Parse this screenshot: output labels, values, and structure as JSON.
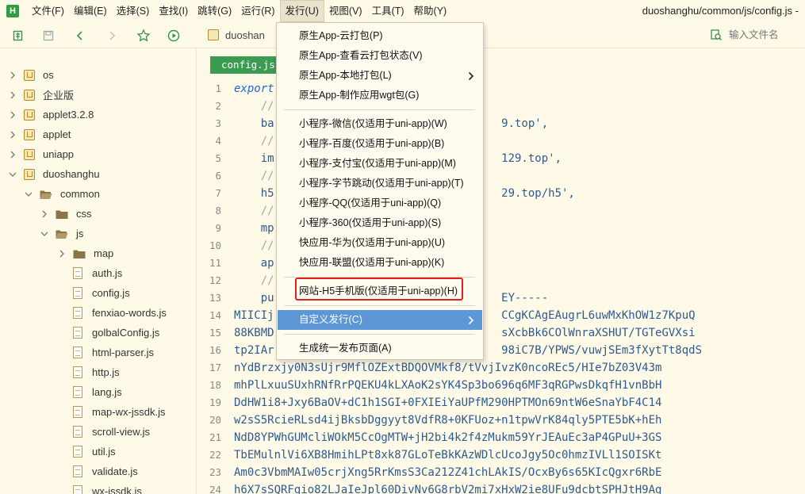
{
  "app": {
    "logo_text": "H",
    "title_path": "duoshanghu/common/js/config.js -"
  },
  "menubar": {
    "items": [
      "文件(F)",
      "编辑(E)",
      "选择(S)",
      "查找(I)",
      "跳转(G)",
      "运行(R)",
      "发行(U)",
      "视图(V)",
      "工具(T)",
      "帮助(Y)"
    ],
    "active": "发行(U)"
  },
  "toolbar": {
    "breadcrumb": "duoshan",
    "file_search_placeholder": "输入文件名",
    "icons": [
      "new-file-icon",
      "save-icon",
      "back-icon",
      "forward-icon",
      "star-icon",
      "run-icon"
    ]
  },
  "sidebar": {
    "tree": [
      {
        "label": "os",
        "type": "project",
        "depth": 0,
        "expanded": false
      },
      {
        "label": "企业版",
        "type": "project",
        "depth": 0,
        "expanded": false
      },
      {
        "label": "applet3.2.8",
        "type": "project",
        "depth": 0,
        "expanded": false
      },
      {
        "label": "applet",
        "type": "project",
        "depth": 0,
        "expanded": false
      },
      {
        "label": "uniapp",
        "type": "project",
        "depth": 0,
        "expanded": false
      },
      {
        "label": "duoshanghu",
        "type": "project",
        "depth": 0,
        "expanded": true
      },
      {
        "label": "common",
        "type": "folder",
        "depth": 1,
        "expanded": true
      },
      {
        "label": "css",
        "type": "folder",
        "depth": 2,
        "expanded": false
      },
      {
        "label": "js",
        "type": "folder",
        "depth": 2,
        "expanded": true
      },
      {
        "label": "map",
        "type": "folder",
        "depth": 3,
        "expanded": false
      },
      {
        "label": "auth.js",
        "type": "file",
        "depth": 3
      },
      {
        "label": "config.js",
        "type": "file",
        "depth": 3
      },
      {
        "label": "fenxiao-words.js",
        "type": "file",
        "depth": 3
      },
      {
        "label": "golbalConfig.js",
        "type": "file",
        "depth": 3
      },
      {
        "label": "html-parser.js",
        "type": "file",
        "depth": 3
      },
      {
        "label": "http.js",
        "type": "file",
        "depth": 3
      },
      {
        "label": "lang.js",
        "type": "file",
        "depth": 3
      },
      {
        "label": "map-wx-jssdk.js",
        "type": "file",
        "depth": 3
      },
      {
        "label": "scroll-view.js",
        "type": "file",
        "depth": 3
      },
      {
        "label": "util.js",
        "type": "file",
        "depth": 3
      },
      {
        "label": "validate.js",
        "type": "file",
        "depth": 3
      },
      {
        "label": "wx-jssdk.js",
        "type": "file",
        "depth": 3
      }
    ]
  },
  "editor": {
    "tab": "config.js",
    "lines": [
      {
        "n": "1",
        "text": "export",
        "cls": "kw"
      },
      {
        "n": "2",
        "text": "    //",
        "cls": "cm"
      },
      {
        "n": "3",
        "text": "    ba                                  9.top',",
        "cls": "str"
      },
      {
        "n": "4",
        "text": "    //",
        "cls": "cm"
      },
      {
        "n": "5",
        "text": "    im                                  129.top',",
        "cls": "str"
      },
      {
        "n": "6",
        "text": "    //",
        "cls": "cm"
      },
      {
        "n": "7",
        "text": "    h5                                  29.top/h5',",
        "cls": "str"
      },
      {
        "n": "8",
        "text": "    //",
        "cls": "cm"
      },
      {
        "n": "9",
        "text": "    mp",
        "cls": "str"
      },
      {
        "n": "10",
        "text": "    //",
        "cls": "cm"
      },
      {
        "n": "11",
        "text": "    ap",
        "cls": "str"
      },
      {
        "n": "12",
        "text": "    //",
        "cls": "cm"
      },
      {
        "n": "13",
        "text": "    pu                                  EY-----",
        "cls": "str"
      },
      {
        "n": "14",
        "text": "MIICIj                                  CCgKCAgEAugrL6uwMxKhOW1z7KpuQ",
        "cls": "str"
      },
      {
        "n": "15",
        "text": "88KBMD                                  sXcbBk6COlWnraXSHUT/TGTeGVXsi",
        "cls": "str"
      },
      {
        "n": "16",
        "text": "tp2IAr                                  98iC7B/YPWS/vuwjSEm3fXytTt8qdS",
        "cls": "str"
      },
      {
        "n": "17",
        "text": "nYdBrzxjy0N3sUjr9MflOZExtBDQOVMkf8/tVvjIvzK0ncoREc5/HIe7bZ03V43m",
        "cls": "str"
      },
      {
        "n": "18",
        "text": "mhPlLxuuSUxhRNfRrPQEKU4kLXAoK2sYK4Sp3bo696q6MF3qRGPwsDkqfH1vnBbH",
        "cls": "str"
      },
      {
        "n": "19",
        "text": "DdHW1i8+Jxy6BaOV+dC1h1SGI+0FXIEiYaUPfM290HPTMOn69ntW6eSnaYbF4C14",
        "cls": "str"
      },
      {
        "n": "20",
        "text": "w2sS5RcieRLsd4ijBksbDggyyt8VdfR8+0KFUoz+n1tpwVrK84qly5PTE5bK+hEh",
        "cls": "str"
      },
      {
        "n": "21",
        "text": "NdD8YPWhGUMcliWOkM5CcOgMTW+jH2bi4k2f4zMukm59YrJEAuEc3aP4GPuU+3GS",
        "cls": "str"
      },
      {
        "n": "22",
        "text": "TbEMulnlVi6XB8HmihLPt8xk87GLoTeBkKAzWDlcUcoJgy5Oc0hmzIVLl1SOISKt",
        "cls": "str"
      },
      {
        "n": "23",
        "text": "Am0c3VbmMAIw05crjXng5RrKmsS3Ca212Z41chLAkIS/OcxBy6s65KIcQgxr6RbE",
        "cls": "str"
      },
      {
        "n": "24",
        "text": "h6X7sSQRFgio82LJaIeJpl60DivNv6G8rbV2mi7xHxW2ie8UFu9dcbtSPHJtH9Ag",
        "cls": "str"
      }
    ]
  },
  "dropdown": {
    "items": [
      {
        "label": "原生App-云打包(P)",
        "submenu": false,
        "highlighted": false,
        "sep_after": false
      },
      {
        "label": "原生App-查看云打包状态(V)",
        "submenu": false,
        "highlighted": false,
        "sep_after": false
      },
      {
        "label": "原生App-本地打包(L)",
        "submenu": true,
        "highlighted": false,
        "sep_after": false
      },
      {
        "label": "原生App-制作应用wgt包(G)",
        "submenu": false,
        "highlighted": false,
        "sep_after": true
      },
      {
        "label": "小程序-微信(仅适用于uni-app)(W)",
        "submenu": false,
        "highlighted": false,
        "sep_after": false
      },
      {
        "label": "小程序-百度(仅适用于uni-app)(B)",
        "submenu": false,
        "highlighted": false,
        "sep_after": false
      },
      {
        "label": "小程序-支付宝(仅适用于uni-app)(M)",
        "submenu": false,
        "highlighted": false,
        "sep_after": false
      },
      {
        "label": "小程序-字节跳动(仅适用于uni-app)(T)",
        "submenu": false,
        "highlighted": false,
        "sep_after": false
      },
      {
        "label": "小程序-QQ(仅适用于uni-app)(Q)",
        "submenu": false,
        "highlighted": false,
        "sep_after": false
      },
      {
        "label": "小程序-360(仅适用于uni-app)(S)",
        "submenu": false,
        "highlighted": false,
        "sep_after": false
      },
      {
        "label": "快应用-华为(仅适用于uni-app)(U)",
        "submenu": false,
        "highlighted": false,
        "sep_after": false
      },
      {
        "label": "快应用-联盟(仅适用于uni-app)(K)",
        "submenu": false,
        "highlighted": false,
        "sep_after": true
      },
      {
        "label": "网站-H5手机版(仅适用于uni-app)(H)",
        "submenu": false,
        "highlighted": false,
        "sep_after": true,
        "boxed": true
      },
      {
        "label": "自定义发行(C)",
        "submenu": true,
        "highlighted": true,
        "sep_after": true
      },
      {
        "label": "生成统一发布页面(A)",
        "submenu": false,
        "highlighted": false,
        "sep_after": false
      }
    ],
    "annotation_color": "#e02020",
    "highlight_color": "#5d97d6"
  }
}
